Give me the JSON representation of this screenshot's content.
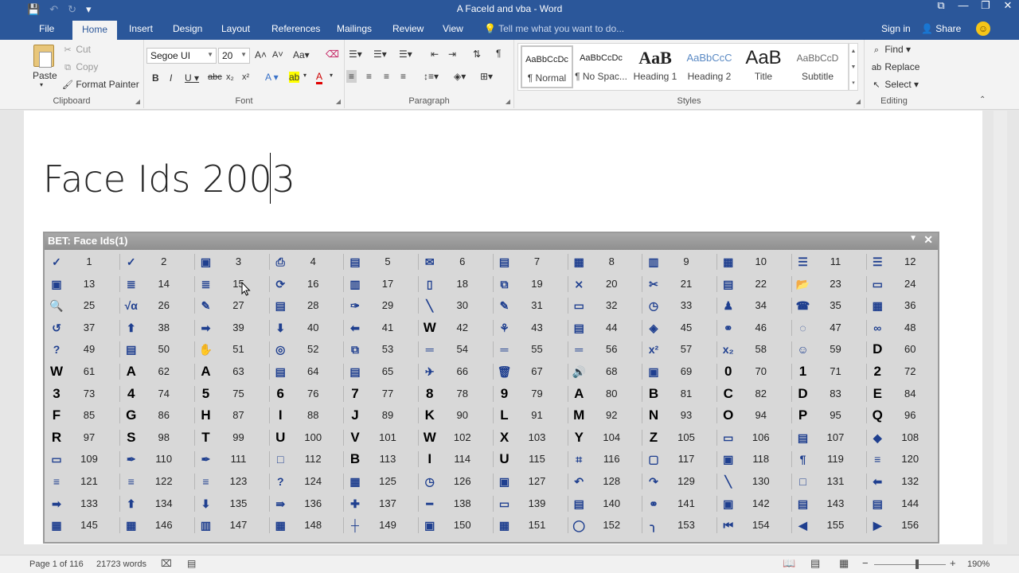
{
  "window": {
    "title": "A FaceId and vba - Word",
    "controls": [
      "⧉",
      "—",
      "❐",
      "✕"
    ]
  },
  "qat": {
    "save": "💾",
    "undo": "↶",
    "redo": "↻",
    "more": "▾"
  },
  "tabs": [
    "File",
    "Home",
    "Insert",
    "Design",
    "Layout",
    "References",
    "Mailings",
    "Review",
    "View"
  ],
  "tell_me": "Tell me what you want to do...",
  "account": {
    "signin": "Sign in",
    "share": "Share"
  },
  "ribbon": {
    "clipboard": {
      "label": "Clipboard",
      "paste": "Paste",
      "cut": "Cut",
      "copy": "Copy",
      "format_painter": "Format Painter"
    },
    "font": {
      "label": "Font",
      "font_name": "Segoe UI",
      "font_size": "20"
    },
    "paragraph": {
      "label": "Paragraph"
    },
    "styles": {
      "label": "Styles",
      "items": [
        {
          "preview": "AaBbCcDc",
          "name": "¶ Normal"
        },
        {
          "preview": "AaBbCcDc",
          "name": "¶ No Spac..."
        },
        {
          "preview": "AaB",
          "name": "Heading 1"
        },
        {
          "preview": "AaBbCcC",
          "name": "Heading 2"
        },
        {
          "preview": "AaB",
          "name": "Title"
        },
        {
          "preview": "AaBbCcD",
          "name": "Subtitle"
        }
      ]
    },
    "editing": {
      "label": "Editing",
      "find": "Find",
      "replace": "Replace",
      "select": "Select"
    }
  },
  "document": {
    "heading": "Face Ids 2003"
  },
  "toolbar": {
    "title": "BET: Face Ids(1)",
    "columns": 12,
    "numbers": [
      "1",
      "2",
      "3",
      "4",
      "5",
      "6",
      "7",
      "8",
      "9",
      "10",
      "11",
      "12",
      "13",
      "14",
      "15",
      "16",
      "17",
      "18",
      "19",
      "20",
      "21",
      "22",
      "23",
      "24",
      "25",
      "26",
      "27",
      "28",
      "29",
      "30",
      "31",
      "32",
      "33",
      "34",
      "35",
      "36",
      "37",
      "38",
      "39",
      "40",
      "41",
      "42",
      "43",
      "44",
      "45",
      "46",
      "47",
      "48",
      "49",
      "50",
      "51",
      "52",
      "53",
      "54",
      "55",
      "56",
      "57",
      "58",
      "59",
      "60",
      "61",
      "62",
      "63",
      "64",
      "65",
      "66",
      "67",
      "68",
      "69",
      "70",
      "71",
      "72",
      "73",
      "74",
      "75",
      "76",
      "77",
      "78",
      "79",
      "80",
      "81",
      "82",
      "83",
      "84",
      "85",
      "86",
      "87",
      "88",
      "89",
      "90",
      "91",
      "92",
      "93",
      "94",
      "95",
      "96",
      "97",
      "98",
      "99",
      "100",
      "101",
      "102",
      "103",
      "104",
      "105",
      "106",
      "107",
      "108",
      "109",
      "110",
      "111",
      "112",
      "113",
      "114",
      "115",
      "116",
      "117",
      "118",
      "119",
      "120",
      "121",
      "122",
      "123",
      "124",
      "125",
      "126",
      "127",
      "128",
      "129",
      "130",
      "131",
      "132",
      "133",
      "134",
      "135",
      "136",
      "137",
      "138",
      "139",
      "140",
      "141",
      "142",
      "143",
      "144",
      "145",
      "146",
      "147",
      "148",
      "149",
      "150",
      "151",
      "152",
      "153",
      "154",
      "155",
      "156"
    ],
    "icons": [
      "✓",
      "✓",
      "▣",
      "⎙",
      "▤",
      "✉",
      "▤",
      "▦",
      "▥",
      "▦",
      "☰",
      "☰",
      "▣",
      "≣",
      "≣",
      "⟳",
      "▥",
      "▯",
      "⧉",
      "⨯",
      "✂",
      "▤",
      "📂",
      "▭",
      "🔍",
      "√α",
      "✎",
      "▤",
      "✑",
      "╲",
      "✎",
      "▭",
      "◷",
      "♟",
      "☎",
      "▦",
      "↺",
      "⬆",
      "➡",
      "⬇",
      "⬅",
      "W",
      "⚘",
      "▤",
      "◈",
      "⚭",
      "◌",
      "∞",
      "?",
      "▤",
      "✋",
      "◎",
      "⧉",
      "═",
      "═",
      "═",
      "x²",
      "x₂",
      "☺",
      "D",
      "W",
      "A",
      "A",
      "▤",
      "▤",
      "✈",
      "🗑",
      "🔊",
      "▣",
      "0",
      "1",
      "2",
      "3",
      "4",
      "5",
      "6",
      "7",
      "8",
      "9",
      "A",
      "B",
      "C",
      "D",
      "E",
      "F",
      "G",
      "H",
      "I",
      "J",
      "K",
      "L",
      "M",
      "N",
      "O",
      "P",
      "Q",
      "R",
      "S",
      "T",
      "U",
      "V",
      "W",
      "X",
      "Y",
      "Z",
      "▭",
      "▤",
      "◆",
      "▭",
      "✒",
      "✒",
      "□",
      "B",
      "I",
      "U",
      "⌗",
      "▢",
      "▣",
      "¶",
      "≡",
      "≡",
      "≡",
      "≡",
      "?",
      "▦",
      "◷",
      "▣",
      "↶",
      "↷",
      "╲",
      "□",
      "⬅",
      "➡",
      "⬆",
      "⬇",
      "⇛",
      "✚",
      "━",
      "▭",
      "▤",
      "⚭",
      "▣",
      "▤",
      "▤",
      "▦",
      "▦",
      "▥",
      "▦",
      "┼",
      "▣",
      "▦",
      "◯",
      "╮",
      "⏮",
      "◀",
      "▶"
    ]
  },
  "status": {
    "page": "Page 1 of 116",
    "words": "21723 words",
    "zoom": "190%",
    "zoom_minus": "−",
    "zoom_plus": "+"
  }
}
